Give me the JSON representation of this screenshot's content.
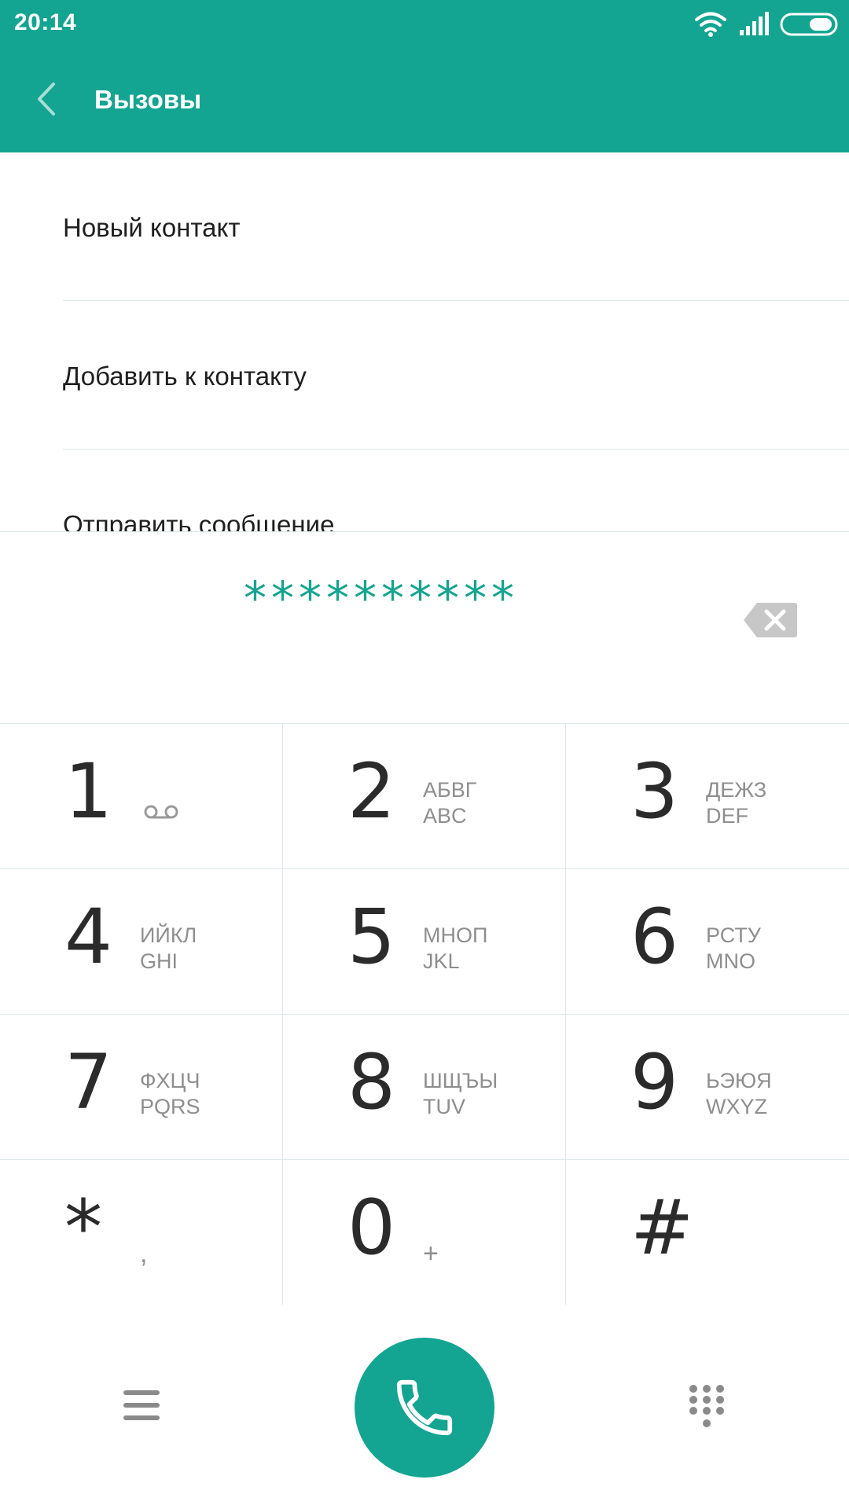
{
  "status_bar": {
    "time": "20:14",
    "icons": [
      "wifi-icon",
      "signal-icon",
      "battery-icon"
    ]
  },
  "header": {
    "title": "Вызовы",
    "back_icon": "chevron-left-icon",
    "background_color": "#13a591"
  },
  "menu": {
    "items": [
      {
        "label": "Новый контакт"
      },
      {
        "label": "Добавить к контакту"
      },
      {
        "label": "Отправить сообщение"
      }
    ]
  },
  "dialer": {
    "number": "**********",
    "delete_icon": "backspace-icon",
    "accent_color": "#13a591"
  },
  "keypad": {
    "keys": [
      {
        "digit": "1",
        "letters_ru": "",
        "letters_en": "",
        "extra": "voicemail-icon"
      },
      {
        "digit": "2",
        "letters_ru": "АБВГ",
        "letters_en": "ABC"
      },
      {
        "digit": "3",
        "letters_ru": "ДЕЖЗ",
        "letters_en": "DEF"
      },
      {
        "digit": "4",
        "letters_ru": "ИЙКЛ",
        "letters_en": "GHI"
      },
      {
        "digit": "5",
        "letters_ru": "МНОП",
        "letters_en": "JKL"
      },
      {
        "digit": "6",
        "letters_ru": "РСТУ",
        "letters_en": "MNO"
      },
      {
        "digit": "7",
        "letters_ru": "ФХЦЧ",
        "letters_en": "PQRS"
      },
      {
        "digit": "8",
        "letters_ru": "ШЩЪЫ",
        "letters_en": "TUV"
      },
      {
        "digit": "9",
        "letters_ru": "ЬЭЮЯ",
        "letters_en": "WXYZ"
      },
      {
        "digit": "*",
        "sub": ","
      },
      {
        "digit": "0",
        "sub": "+"
      },
      {
        "digit": "#",
        "sub": ""
      }
    ]
  },
  "bottom_bar": {
    "icons": [
      "menu-icon",
      "phone-icon",
      "dialpad-icon"
    ]
  }
}
